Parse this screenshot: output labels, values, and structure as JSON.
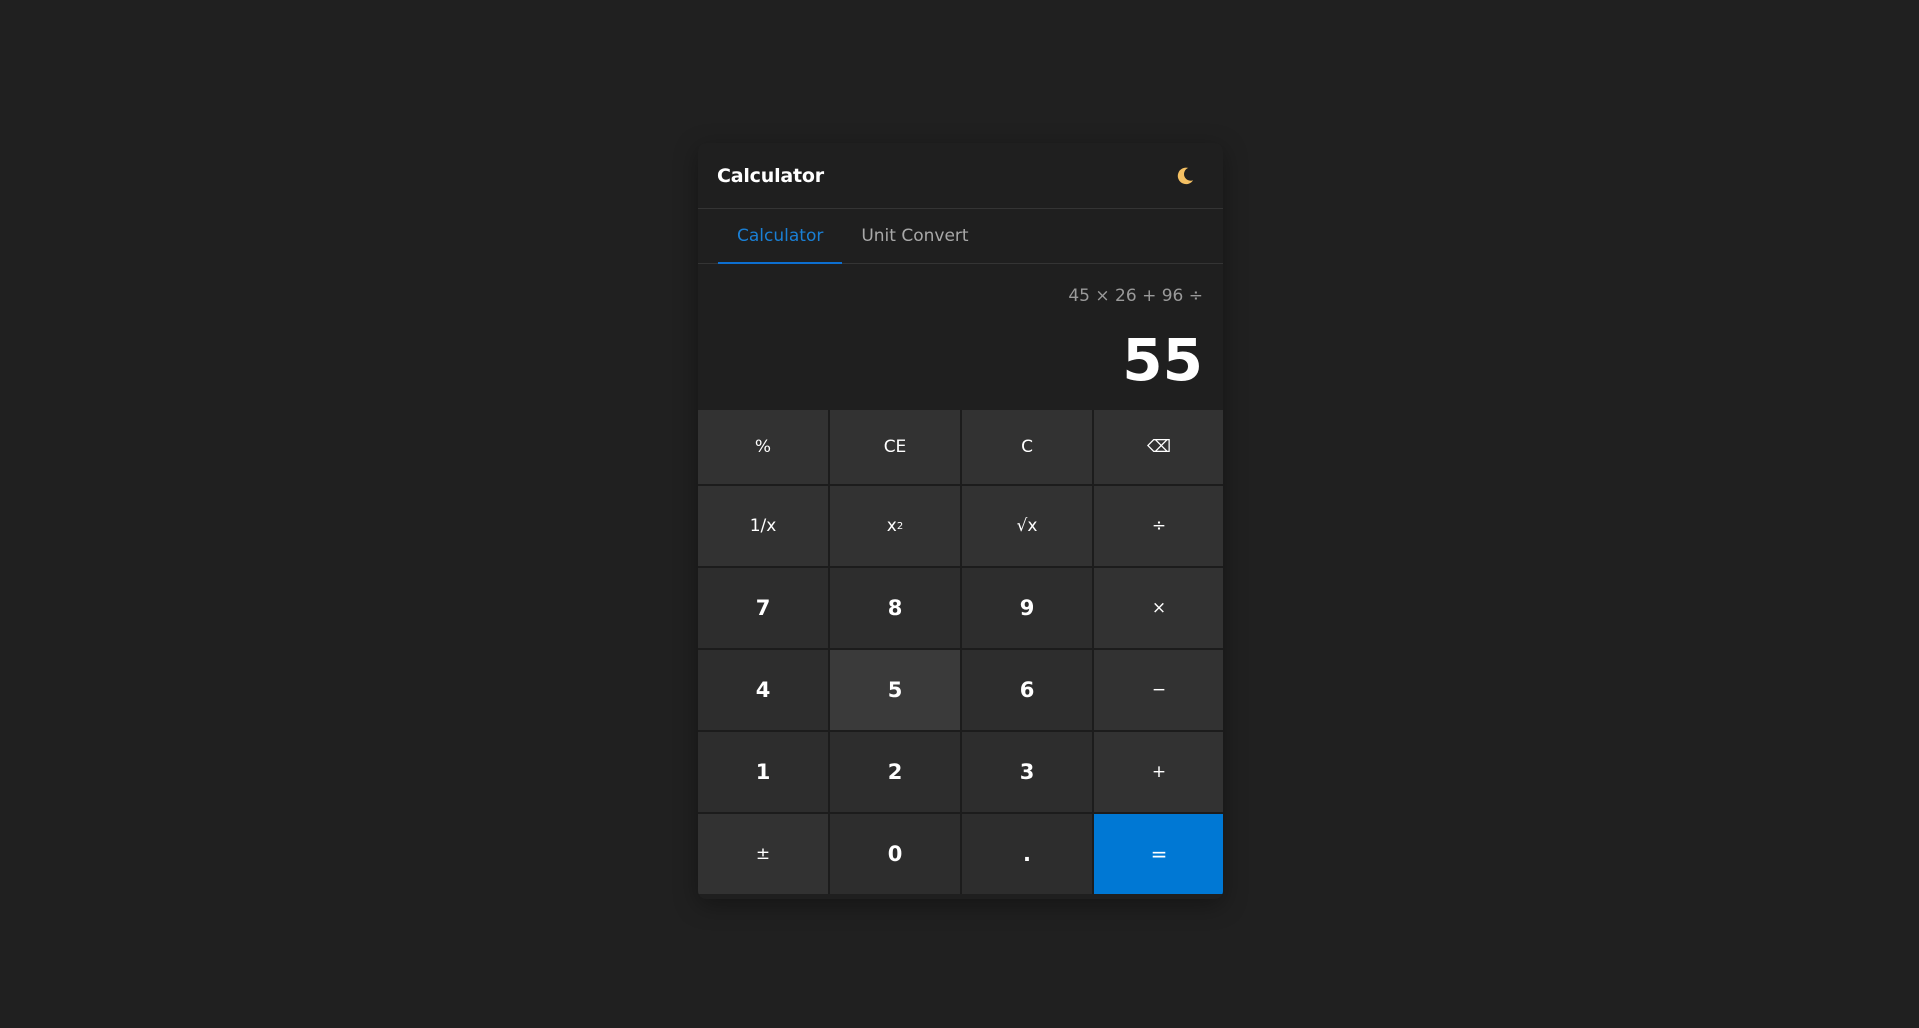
{
  "app": {
    "title": "Calculator",
    "theme_icon": "moon-icon"
  },
  "tabs": [
    {
      "label": "Calculator",
      "active": true
    },
    {
      "label": "Unit Convert",
      "active": false
    }
  ],
  "display": {
    "expression": "45 × 26 + 96 ÷",
    "result": "55"
  },
  "keys": {
    "percent": "%",
    "clear_entry": "CE",
    "clear": "C",
    "backspace": "⌫",
    "reciprocal": "1/x",
    "square_base": "x",
    "square_exp": "2",
    "sqrt": "√x",
    "divide": "÷",
    "seven": "7",
    "eight": "8",
    "nine": "9",
    "multiply": "×",
    "four": "4",
    "five": "5",
    "six": "6",
    "minus": "−",
    "one": "1",
    "two": "2",
    "three": "3",
    "plus": "+",
    "negate": "±",
    "zero": "0",
    "decimal": ".",
    "equals": "="
  },
  "colors": {
    "accent": "#0078d4",
    "background": "#202020",
    "key": "#323232",
    "number_key": "#2d2d2d"
  }
}
